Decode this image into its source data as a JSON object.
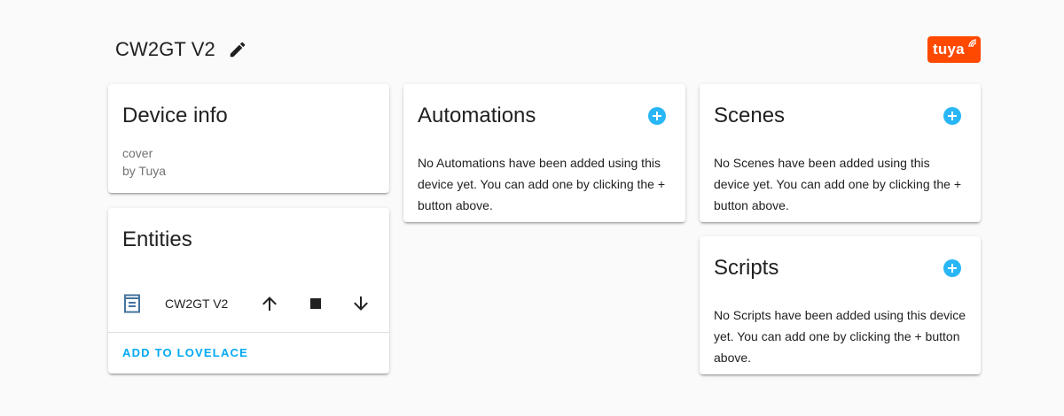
{
  "header": {
    "device_name": "CW2GT V2",
    "edit_icon": "pencil-icon",
    "brand": {
      "text": "tuya",
      "color": "#ff4800"
    }
  },
  "device_info": {
    "title": "Device info",
    "model": "cover",
    "manufacturer": "by Tuya"
  },
  "entities": {
    "title": "Entities",
    "items": [
      {
        "icon": "window-shutter-icon",
        "name": "CW2GT V2",
        "controls": [
          "arrow-up-icon",
          "stop-icon",
          "arrow-down-icon"
        ]
      }
    ],
    "add_button": "ADD TO LOVELACE"
  },
  "automations": {
    "title": "Automations",
    "empty_text": "No Automations have been added using this device yet. You can add one by clicking the + button above."
  },
  "scenes": {
    "title": "Scenes",
    "empty_text": "No Scenes have been added using this device yet. You can add one by clicking the + button above."
  },
  "scripts": {
    "title": "Scripts",
    "empty_text": "No Scripts have been added using this device yet. You can add one by clicking the + button above."
  },
  "colors": {
    "accent": "#03a9f4",
    "add_icon": "#29b6f6",
    "icon_primary": "#44739e",
    "background": "#fafafa"
  }
}
